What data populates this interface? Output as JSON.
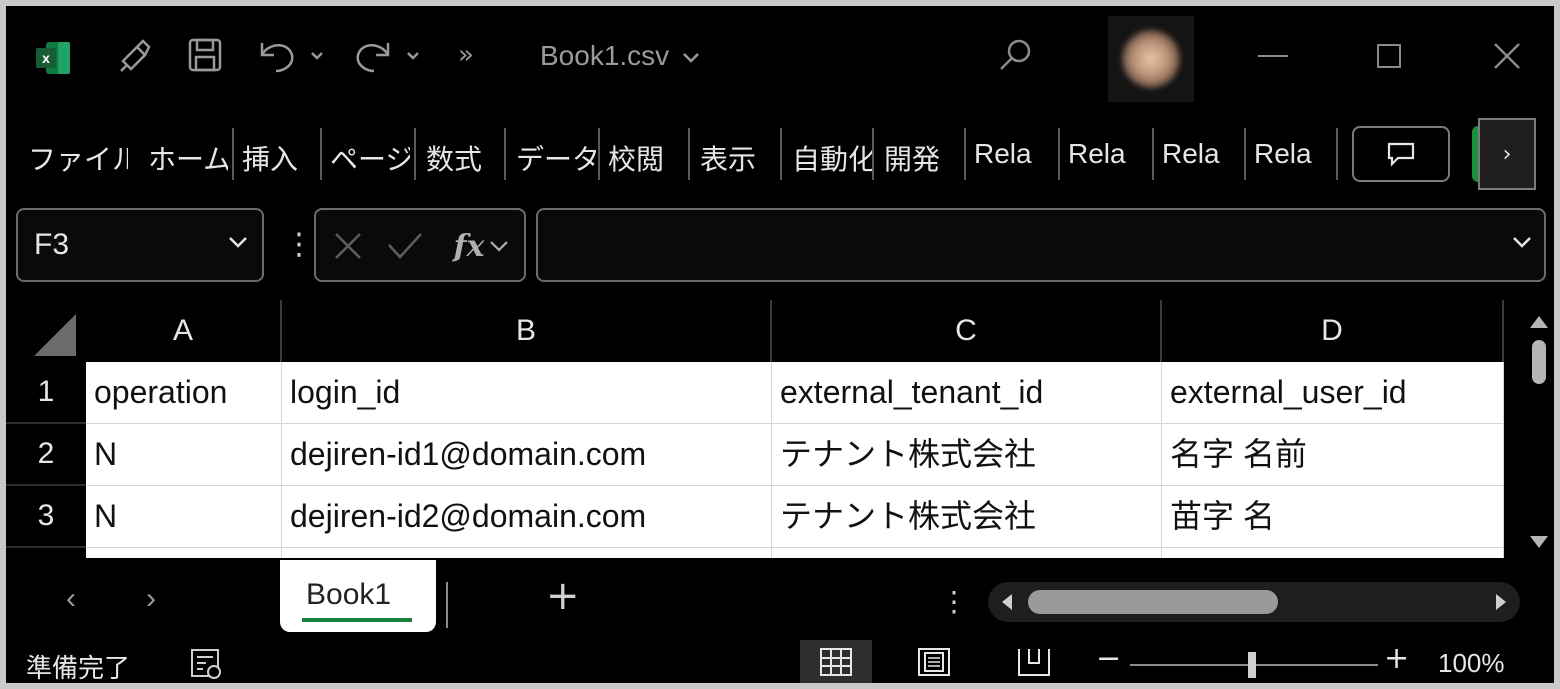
{
  "title_bar": {
    "document_title": "Book1.csv",
    "icons": [
      "excel-logo",
      "format-painter-icon",
      "save-icon",
      "undo-icon",
      "redo-icon",
      "more-commands-icon",
      "search-icon",
      "minimize-icon",
      "maximize-icon",
      "close-icon"
    ]
  },
  "ribbon": {
    "tabs": [
      {
        "label": "ファイル"
      },
      {
        "label": "ホーム"
      },
      {
        "label": "挿入"
      },
      {
        "label": "ページ"
      },
      {
        "label": "数式"
      },
      {
        "label": "データ"
      },
      {
        "label": "校閲"
      },
      {
        "label": "表示"
      },
      {
        "label": "自動化"
      },
      {
        "label": "開発"
      },
      {
        "label": "Rela"
      },
      {
        "label": "Rela"
      },
      {
        "label": "Rela"
      },
      {
        "label": "Rela"
      }
    ],
    "more_label": "›"
  },
  "formula_bar": {
    "name_box": "F3",
    "formula": ""
  },
  "sheet": {
    "columns": [
      "A",
      "B",
      "C",
      "D"
    ],
    "row_numbers": [
      "1",
      "2",
      "3"
    ],
    "rows": [
      [
        "operation",
        "login_id",
        "external_tenant_id",
        "external_user_id"
      ],
      [
        "N",
        "dejiren-id1@domain.com",
        "テナント株式会社",
        "名字 名前"
      ],
      [
        "N",
        "dejiren-id2@domain.com",
        "テナント株式会社",
        "苗字 名"
      ]
    ]
  },
  "tab_bar": {
    "prev": "‹",
    "next": "›",
    "sheet_name": "Book1",
    "add": "+",
    "dots": "⋮"
  },
  "status_bar": {
    "status": "準備完了",
    "zoom_minus": "−",
    "zoom_plus": "+",
    "zoom": "100%",
    "zoom_level_percent": 100
  }
}
